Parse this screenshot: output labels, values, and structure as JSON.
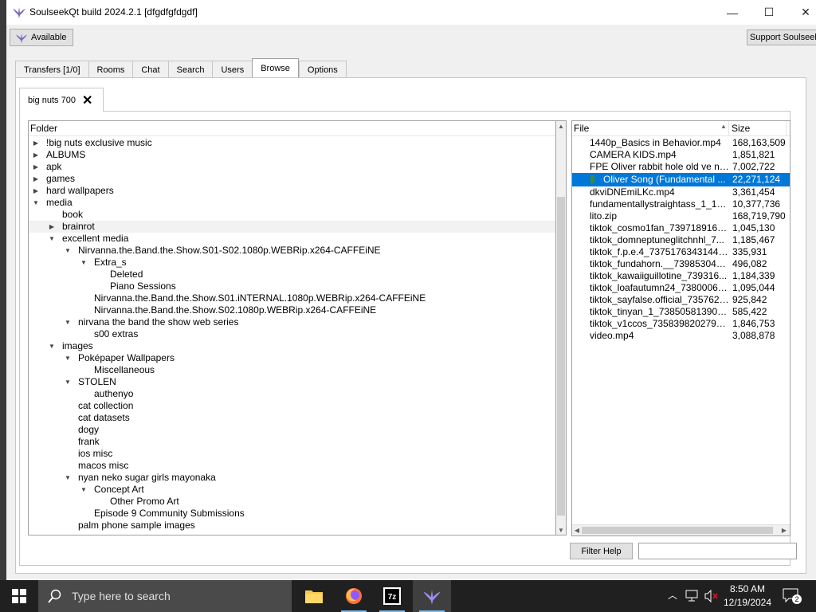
{
  "window": {
    "title": "SoulseekQt build 2024.2.1 [dfgdfgfdgdf]",
    "minimize_glyph": "—",
    "maximize_glyph": "☐",
    "close_glyph": "✕"
  },
  "toolbar": {
    "status_label": "Available",
    "support_label": "Support Soulseek"
  },
  "tabs": [
    {
      "label": "Transfers [1/0]"
    },
    {
      "label": "Rooms"
    },
    {
      "label": "Chat"
    },
    {
      "label": "Search"
    },
    {
      "label": "Users"
    },
    {
      "label": "Browse",
      "active": true
    },
    {
      "label": "Options"
    }
  ],
  "browse": {
    "user_tab_label": "big nuts 700",
    "user_tab_close": "✕",
    "folder_header": "Folder",
    "folders": [
      {
        "label": "!big nuts exclusive music",
        "depth": 0,
        "state": "collapsed"
      },
      {
        "label": "ALBUMS",
        "depth": 0,
        "state": "collapsed"
      },
      {
        "label": "apk",
        "depth": 0,
        "state": "collapsed"
      },
      {
        "label": "games",
        "depth": 0,
        "state": "collapsed"
      },
      {
        "label": "hard wallpapers",
        "depth": 0,
        "state": "collapsed"
      },
      {
        "label": "media",
        "depth": 0,
        "state": "expanded"
      },
      {
        "label": "book",
        "depth": 1,
        "state": "leaf"
      },
      {
        "label": "brainrot",
        "depth": 1,
        "state": "collapsed",
        "hover": true
      },
      {
        "label": "excellent media",
        "depth": 1,
        "state": "expanded"
      },
      {
        "label": "Nirvanna.the.Band.the.Show.S01-S02.1080p.WEBRip.x264-CAFFEiNE",
        "depth": 2,
        "state": "expanded"
      },
      {
        "label": "Extra_s",
        "depth": 3,
        "state": "expanded"
      },
      {
        "label": "Deleted",
        "depth": 4,
        "state": "leaf"
      },
      {
        "label": "Piano Sessions",
        "depth": 4,
        "state": "leaf"
      },
      {
        "label": "Nirvanna.the.Band.the.Show.S01.iNTERNAL.1080p.WEBRip.x264-CAFFEiNE",
        "depth": 3,
        "state": "leaf"
      },
      {
        "label": "Nirvanna.the.Band.the.Show.S02.1080p.WEBRip.x264-CAFFEiNE",
        "depth": 3,
        "state": "leaf"
      },
      {
        "label": "nirvana the band the show web series",
        "depth": 2,
        "state": "expanded"
      },
      {
        "label": "s00 extras",
        "depth": 3,
        "state": "leaf"
      },
      {
        "label": "images",
        "depth": 1,
        "state": "expanded"
      },
      {
        "label": "Poképaper Wallpapers",
        "depth": 2,
        "state": "expanded"
      },
      {
        "label": "Miscellaneous",
        "depth": 3,
        "state": "leaf"
      },
      {
        "label": "STOLEN",
        "depth": 2,
        "state": "expanded"
      },
      {
        "label": "authenyo",
        "depth": 3,
        "state": "leaf"
      },
      {
        "label": "cat collection",
        "depth": 2,
        "state": "leaf"
      },
      {
        "label": "cat datasets",
        "depth": 2,
        "state": "leaf"
      },
      {
        "label": "dogy",
        "depth": 2,
        "state": "leaf"
      },
      {
        "label": "frank",
        "depth": 2,
        "state": "leaf"
      },
      {
        "label": "ios misc",
        "depth": 2,
        "state": "leaf"
      },
      {
        "label": "macos misc",
        "depth": 2,
        "state": "leaf"
      },
      {
        "label": "nyan neko sugar girls mayonaka",
        "depth": 2,
        "state": "expanded"
      },
      {
        "label": "Concept Art",
        "depth": 3,
        "state": "expanded"
      },
      {
        "label": "Other Promo Art",
        "depth": 4,
        "state": "leaf"
      },
      {
        "label": "Episode 9 Community Submissions",
        "depth": 3,
        "state": "leaf"
      },
      {
        "label": "palm phone sample images",
        "depth": 2,
        "state": "leaf"
      }
    ],
    "file_header": {
      "file": "File",
      "size": "Size",
      "sort_glyph": "▲"
    },
    "files": [
      {
        "name": "1440p_Basics in Behavior.mp4",
        "size": "168,163,509"
      },
      {
        "name": "CAMERA KIDS.mp4",
        "size": "1,851,821"
      },
      {
        "name": "FPE Oliver rabbit hole old ve ne...",
        "size": "7,002,722"
      },
      {
        "name": "Oliver Song (Fundamental ...",
        "size": "22,271,124",
        "selected": true
      },
      {
        "name": "dkviDNEmiLKc.mp4",
        "size": "3,361,454"
      },
      {
        "name": "fundamentallystraightass_1_1_...",
        "size": "10,377,736"
      },
      {
        "name": "lito.zip",
        "size": "168,719,790"
      },
      {
        "name": "tiktok_cosmo1fan_7397189160...",
        "size": "1,045,130"
      },
      {
        "name": "tiktok_domneptuneglitchnhl_7...",
        "size": "1,185,467"
      },
      {
        "name": "tiktok_f.p.e.4_737517634314477...",
        "size": "335,931"
      },
      {
        "name": "tiktok_fundahorn.__7398530439...",
        "size": "496,082"
      },
      {
        "name": "tiktok_kawaiiguillotine_739316...",
        "size": "1,184,339"
      },
      {
        "name": "tiktok_loafautumn24_73800069...",
        "size": "1,095,044"
      },
      {
        "name": "tiktok_sayfalse.official_7357624...",
        "size": "925,842"
      },
      {
        "name": "tiktok_tinyan_1_7385058139067...",
        "size": "585,422"
      },
      {
        "name": "tiktok_v1ccos_73583982027998...",
        "size": "1,846,753"
      },
      {
        "name": "video.mp4",
        "size": "3,088,878"
      }
    ],
    "filter_help_label": "Filter Help",
    "filter_value": ""
  },
  "taskbar": {
    "search_placeholder": "Type here to search",
    "time": "8:50 AM",
    "date": "12/19/2024",
    "notification_count": "2",
    "apps": [
      "file-explorer",
      "firefox",
      "7-zip",
      "soulseekqt"
    ]
  },
  "colors": {
    "selection": "#0078d7",
    "taskbar": "#202020",
    "accent_soulseek": "#6a5acd"
  }
}
